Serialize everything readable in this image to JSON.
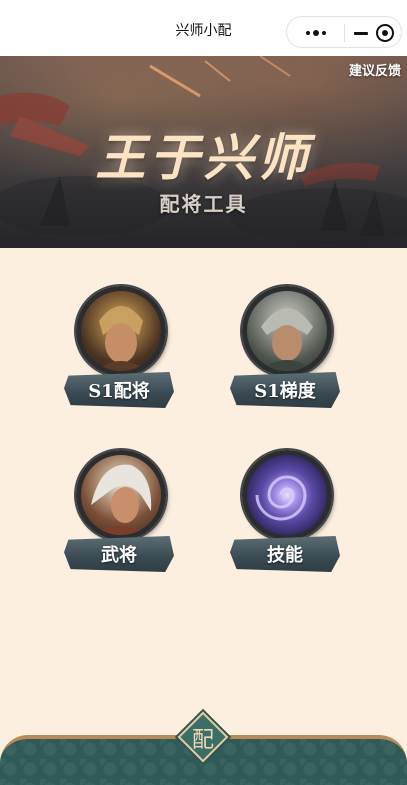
{
  "app": {
    "title": "兴师小配"
  },
  "capsule": {
    "more_icon": "more-dots-icon",
    "minimize_icon": "minimize-icon",
    "close_icon": "close-target-icon"
  },
  "banner": {
    "feedback_label": "建议反馈",
    "title": "王于兴师",
    "subtitle": "配将工具"
  },
  "menu": {
    "items": [
      {
        "label": "S1配将",
        "icon": "general-portrait-icon"
      },
      {
        "label": "S1梯度",
        "icon": "helmet-general-portrait-icon"
      },
      {
        "label": "武将",
        "icon": "white-hair-general-portrait-icon"
      },
      {
        "label": "技能",
        "icon": "purple-swirl-skill-icon"
      }
    ]
  },
  "footer": {
    "badge_char": "配"
  },
  "colors": {
    "page_bg": "#fdefe0",
    "footer_bg": "#2f5a56",
    "footer_border": "#b98b5a",
    "title_text": "#fbe3c3"
  }
}
